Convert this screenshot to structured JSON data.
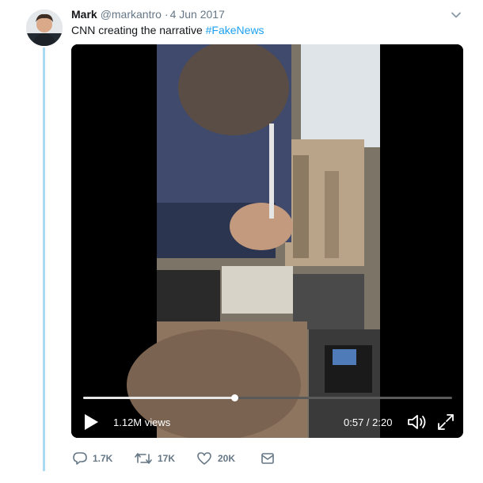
{
  "tweet": {
    "author_name": "Mark",
    "handle": "@markantro",
    "separator": "·",
    "date": "4 Jun 2017",
    "text_main": "CNN creating the narrative ",
    "hashtag": "#FakeNews"
  },
  "video": {
    "views": "1.12M views",
    "time": "0:57 / 2:20",
    "progress_fraction": 0.41
  },
  "actions": {
    "replies": "1.7K",
    "retweets": "17K",
    "likes": "20K"
  },
  "colors": {
    "accent": "#1da1f2",
    "thread_line": "#a9dcf2",
    "muted": "#657786"
  },
  "icons": [
    "chevron-down-icon",
    "play-icon",
    "volume-icon",
    "fullscreen-icon",
    "reply-icon",
    "retweet-icon",
    "like-icon",
    "share-icon"
  ]
}
